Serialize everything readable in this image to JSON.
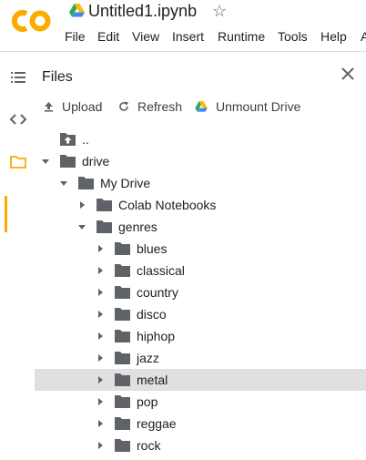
{
  "header": {
    "logo_text": "CO",
    "notebook_title": "Untitled1.ipynb",
    "menu": [
      "File",
      "Edit",
      "View",
      "Insert",
      "Runtime",
      "Tools",
      "Help",
      "A"
    ]
  },
  "rail": {
    "icons": [
      "toc-icon",
      "code-snippets-icon",
      "files-icon"
    ]
  },
  "panel": {
    "title": "Files",
    "toolbar": {
      "upload": "Upload",
      "refresh": "Refresh",
      "unmount": "Unmount Drive"
    }
  },
  "tree": {
    "items": [
      {
        "label": "..",
        "depth": 0,
        "kind": "parent"
      },
      {
        "label": "drive",
        "depth": 0,
        "kind": "folder",
        "expanded": true
      },
      {
        "label": "My Drive",
        "depth": 1,
        "kind": "folder",
        "expanded": true
      },
      {
        "label": "Colab Notebooks",
        "depth": 2,
        "kind": "folder",
        "expanded": false
      },
      {
        "label": "genres",
        "depth": 2,
        "kind": "folder",
        "expanded": true
      },
      {
        "label": "blues",
        "depth": 3,
        "kind": "folder",
        "expanded": false
      },
      {
        "label": "classical",
        "depth": 3,
        "kind": "folder",
        "expanded": false
      },
      {
        "label": "country",
        "depth": 3,
        "kind": "folder",
        "expanded": false
      },
      {
        "label": "disco",
        "depth": 3,
        "kind": "folder",
        "expanded": false
      },
      {
        "label": "hiphop",
        "depth": 3,
        "kind": "folder",
        "expanded": false
      },
      {
        "label": "jazz",
        "depth": 3,
        "kind": "folder",
        "expanded": false
      },
      {
        "label": "metal",
        "depth": 3,
        "kind": "folder",
        "expanded": false,
        "selected": true
      },
      {
        "label": "pop",
        "depth": 3,
        "kind": "folder",
        "expanded": false
      },
      {
        "label": "reggae",
        "depth": 3,
        "kind": "folder",
        "expanded": false
      },
      {
        "label": "rock",
        "depth": 3,
        "kind": "folder",
        "expanded": false
      }
    ]
  },
  "colors": {
    "accent": "#f9ab00",
    "logo_orange": "#f9ab00",
    "icon_gray": "#5f6368",
    "folder_gray": "#5f6368",
    "selected_row": "#e0e0e0"
  }
}
